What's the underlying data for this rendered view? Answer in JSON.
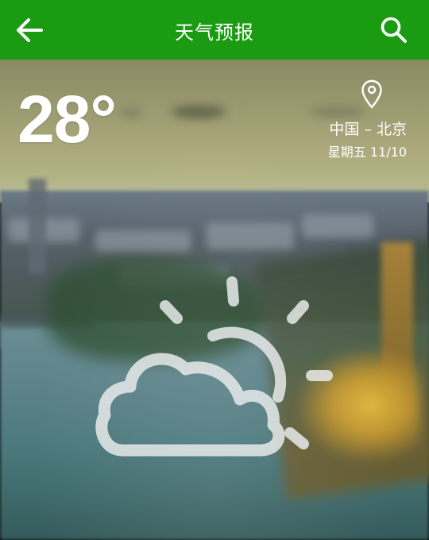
{
  "appbar": {
    "title": "天气预报",
    "back_icon": "arrow-left-icon",
    "search_icon": "search-icon",
    "color": "#1a9b12"
  },
  "weather": {
    "temperature": "28°",
    "location_icon": "location-pin-icon",
    "location": "中国 – 北京",
    "date": "星期五 11/10",
    "condition_icon": "partly-cloudy-icon"
  }
}
